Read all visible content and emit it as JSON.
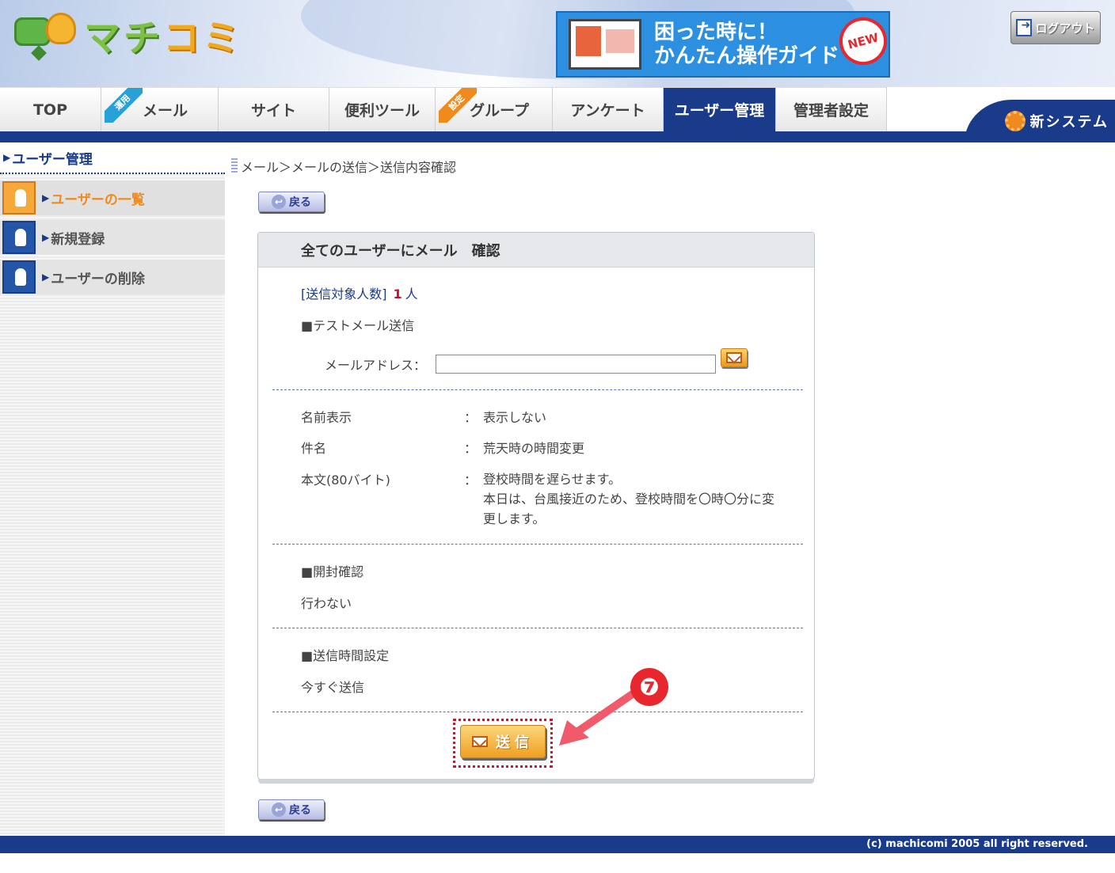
{
  "header": {
    "logo_text": [
      "マチ",
      "コミ"
    ],
    "guide_banner": {
      "line1": "困った時に！",
      "line2": "かんたん操作ガイド",
      "badge": "NEW"
    },
    "logout_label": "ログアウト"
  },
  "nav": {
    "tabs": [
      {
        "label": "TOP",
        "ribbon": ""
      },
      {
        "label": "メール",
        "ribbon": "運用"
      },
      {
        "label": "サイト",
        "ribbon": ""
      },
      {
        "label": "便利ツール",
        "ribbon": ""
      },
      {
        "label": "グループ",
        "ribbon": "設定"
      },
      {
        "label": "アンケート",
        "ribbon": ""
      },
      {
        "label": "ユーザー管理",
        "ribbon": "",
        "active": true
      },
      {
        "label": "管理者設定",
        "ribbon": ""
      }
    ],
    "new_system_label": "新システム"
  },
  "sidebar": {
    "title": "ユーザー管理",
    "items": [
      {
        "label": "ユーザーの一覧",
        "icon": "user-list-icon",
        "active": true
      },
      {
        "label": "新規登録",
        "icon": "user-add-icon"
      },
      {
        "label": "ユーザーの削除",
        "icon": "user-delete-icon"
      }
    ]
  },
  "main": {
    "breadcrumb": "メール＞メールの送信＞送信内容確認",
    "back_label": "戻る",
    "panel": {
      "title": "全てのユーザーにメール　確認",
      "recipient_count_label": "[送信対象人数]",
      "recipient_count_value": "1",
      "recipient_count_unit": "人",
      "test_mail_heading": "■テストメール送信",
      "email_label": "メールアドレス：",
      "email_value": "",
      "fields": [
        {
          "label": "名前表示",
          "value": "表示しない"
        },
        {
          "label": "件名",
          "value": "荒天時の時間変更"
        },
        {
          "label": "本文(80バイト)",
          "value_lines": [
            "登校時間を遅らせます。",
            "本日は、台風接近のため、登校時間を〇時〇分に変",
            "更します。"
          ]
        }
      ],
      "colon": "：",
      "open_check_heading": "■開封確認",
      "open_check_value": "行わない",
      "send_time_heading": "■送信時間設定",
      "send_time_value": "今すぐ送信",
      "send_label": "送信"
    },
    "step_badge": "❼"
  },
  "footer": {
    "copyright": "(c) machicomi 2005 all right reserved."
  },
  "colors": {
    "navy": "#1a3a8a",
    "orange": "#f08a1e",
    "red": "#e8262e"
  }
}
